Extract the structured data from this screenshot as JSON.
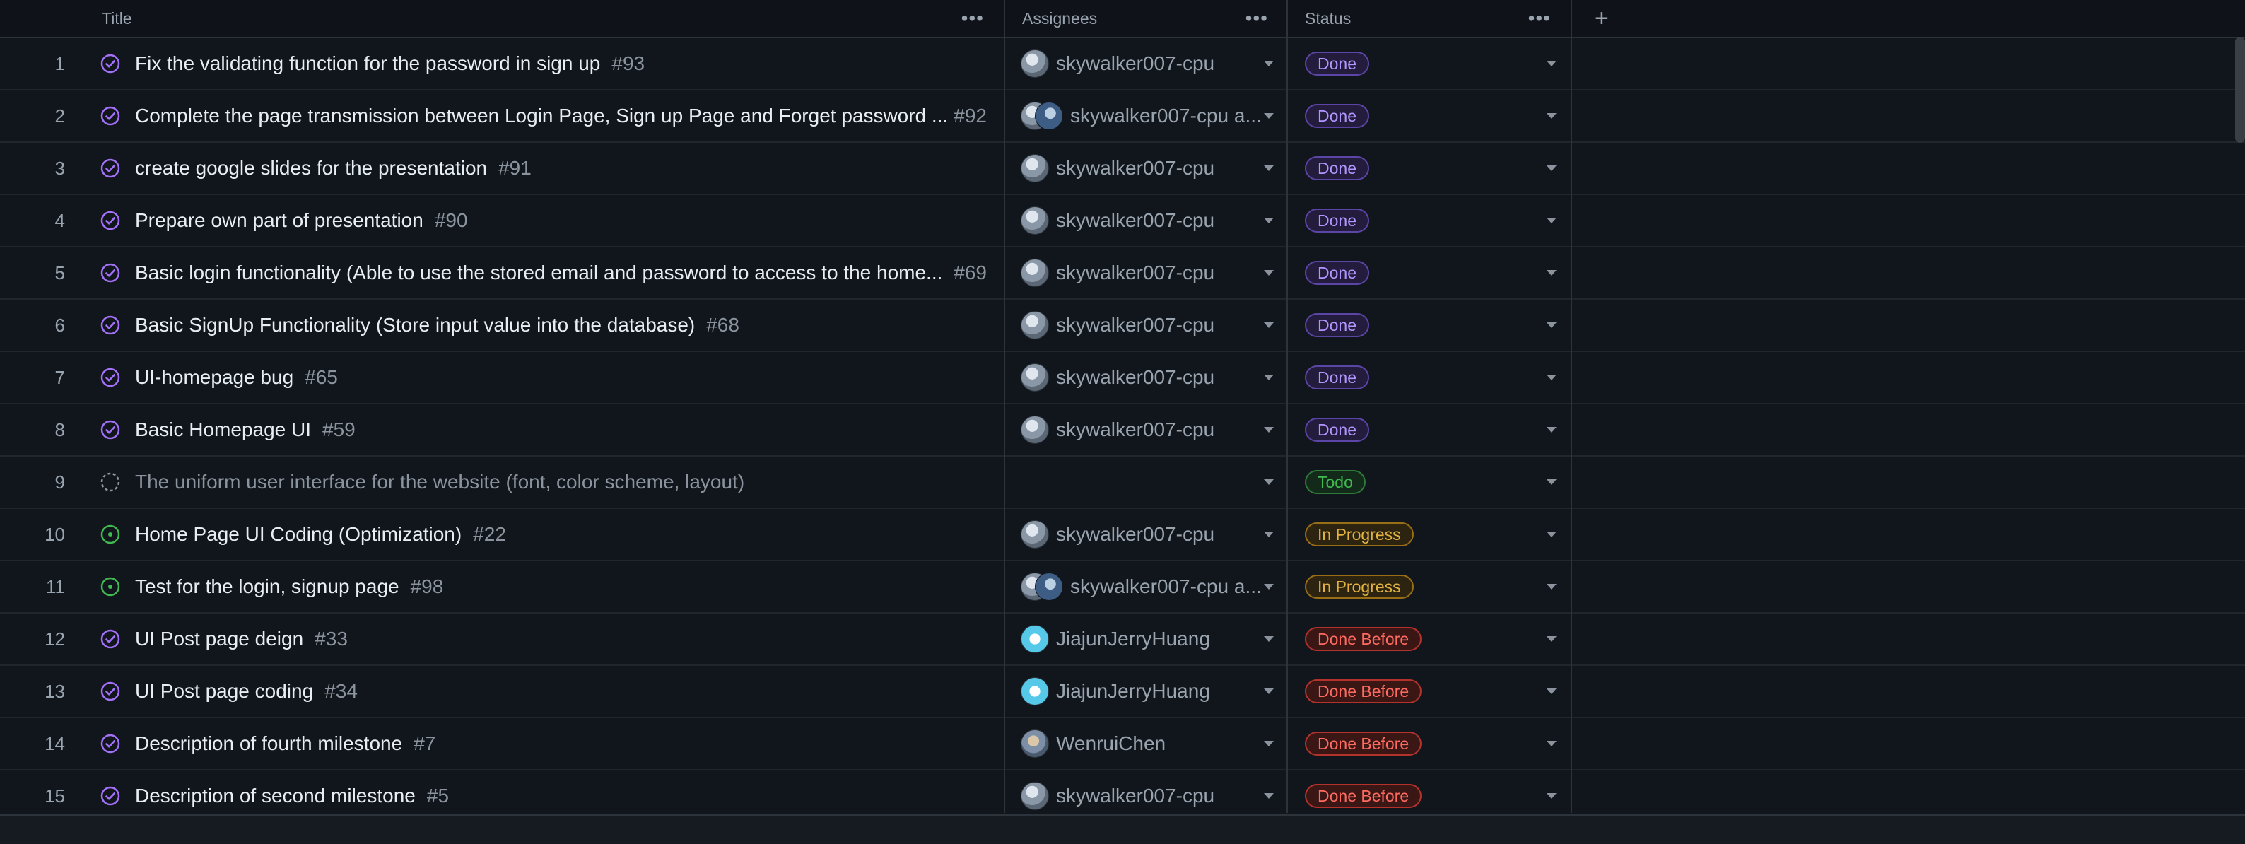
{
  "columns": {
    "title": "Title",
    "assignees": "Assignees",
    "status": "Status",
    "add": "+"
  },
  "rows": [
    {
      "n": "1",
      "title": "Fix the validating function for the password in sign up",
      "issue": "#93",
      "assignee": "skywalker007-cpu",
      "status": "Done",
      "type": "done",
      "icon": "closed"
    },
    {
      "n": "2",
      "title": "Complete the page transmission between Login Page, Sign up Page and Forget password ...",
      "issue": "#92",
      "assignee": "skywalker007-cpu a...",
      "status": "Done",
      "type": "done",
      "icon": "closed"
    },
    {
      "n": "3",
      "title": "create google slides for the presentation",
      "issue": "#91",
      "assignee": "skywalker007-cpu",
      "status": "Done",
      "type": "done",
      "icon": "closed"
    },
    {
      "n": "4",
      "title": "Prepare own part of presentation",
      "issue": "#90",
      "assignee": "skywalker007-cpu",
      "status": "Done",
      "type": "done",
      "icon": "closed"
    },
    {
      "n": "5",
      "title": "Basic login functionality (Able to use the stored email and password to access to the home...",
      "issue": "#69",
      "assignee": "skywalker007-cpu",
      "status": "Done",
      "type": "done",
      "icon": "closed"
    },
    {
      "n": "6",
      "title": "Basic SignUp Functionality (Store input value into the database)",
      "issue": "#68",
      "assignee": "skywalker007-cpu",
      "status": "Done",
      "type": "done",
      "icon": "closed"
    },
    {
      "n": "7",
      "title": "UI-homepage bug",
      "issue": "#65",
      "assignee": "skywalker007-cpu",
      "status": "Done",
      "type": "done",
      "icon": "closed"
    },
    {
      "n": "8",
      "title": "Basic Homepage UI",
      "issue": "#59",
      "assignee": "skywalker007-cpu",
      "status": "Done",
      "type": "done",
      "icon": "closed"
    },
    {
      "n": "9",
      "title": "The uniform user interface for the website (font, color scheme, layout)",
      "issue": "",
      "assignee": "",
      "status": "Todo",
      "type": "todo",
      "icon": "draft"
    },
    {
      "n": "10",
      "title": "Home Page UI Coding (Optimization)",
      "issue": "#22",
      "assignee": "skywalker007-cpu",
      "status": "In Progress",
      "type": "prog",
      "icon": "open"
    },
    {
      "n": "11",
      "title": "Test for the login, signup page",
      "issue": "#98",
      "assignee": "skywalker007-cpu a...",
      "status": "In Progress",
      "type": "prog",
      "icon": "open"
    },
    {
      "n": "12",
      "title": "UI Post page deign",
      "issue": "#33",
      "assignee": "JiajunJerryHuang",
      "status": "Done Before",
      "type": "before",
      "icon": "closed"
    },
    {
      "n": "13",
      "title": "UI Post page coding",
      "issue": "#34",
      "assignee": "JiajunJerryHuang",
      "status": "Done Before",
      "type": "before",
      "icon": "closed"
    },
    {
      "n": "14",
      "title": "Description of fourth milestone",
      "issue": "#7",
      "assignee": "WenruiChen",
      "status": "Done Before",
      "type": "before",
      "icon": "closed"
    },
    {
      "n": "15",
      "title": "Description of second milestone",
      "issue": "#5",
      "assignee": "skywalker007-cpu",
      "status": "Done Before",
      "type": "before",
      "icon": "closed"
    }
  ]
}
